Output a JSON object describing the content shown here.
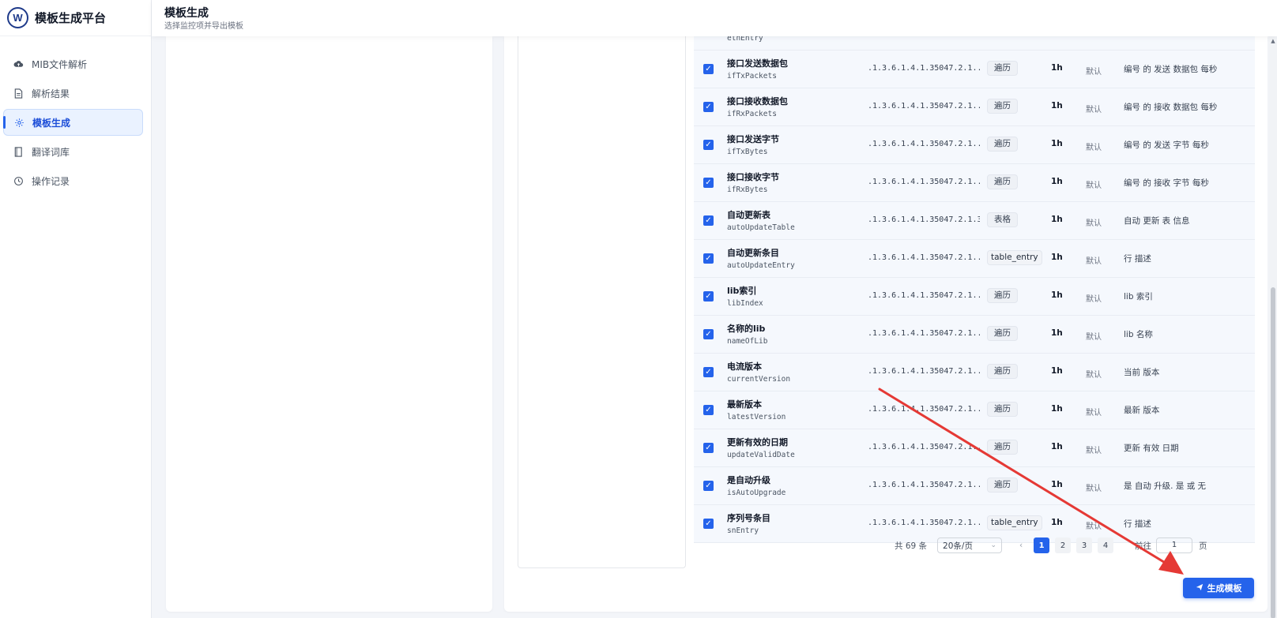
{
  "app": {
    "logo_text": "W",
    "title": "模板生成平台"
  },
  "sidebar": {
    "items": [
      {
        "label": "MIB文件解析",
        "icon": "cloud-upload-icon"
      },
      {
        "label": "解析结果",
        "icon": "document-icon"
      },
      {
        "label": "模板生成",
        "icon": "gear-icon",
        "active": true
      },
      {
        "label": "翻译词库",
        "icon": "book-icon"
      },
      {
        "label": "操作记录",
        "icon": "clock-icon"
      }
    ]
  },
  "header": {
    "title": "模板生成",
    "subtitle": "选择监控项并导出模板"
  },
  "table": {
    "partial_row": {
      "en": "ethEntry"
    },
    "rows": [
      {
        "cn": "接口发送数据包",
        "en": "ifTxPackets",
        "oid": ".1.3.6.1.4.1.35047.2.1...",
        "type": "遍历",
        "interval": "1h",
        "mode": "默认",
        "desc": "编号 的 发送 数据包 每秒"
      },
      {
        "cn": "接口接收数据包",
        "en": "ifRxPackets",
        "oid": ".1.3.6.1.4.1.35047.2.1...",
        "type": "遍历",
        "interval": "1h",
        "mode": "默认",
        "desc": "编号 的 接收 数据包 每秒"
      },
      {
        "cn": "接口发送字节",
        "en": "ifTxBytes",
        "oid": ".1.3.6.1.4.1.35047.2.1...",
        "type": "遍历",
        "interval": "1h",
        "mode": "默认",
        "desc": "编号 的 发送 字节 每秒"
      },
      {
        "cn": "接口接收字节",
        "en": "ifRxBytes",
        "oid": ".1.3.6.1.4.1.35047.2.1...",
        "type": "遍历",
        "interval": "1h",
        "mode": "默认",
        "desc": "编号 的 接收 字节 每秒"
      },
      {
        "cn": "自动更新表",
        "en": "autoUpdateTable",
        "oid": ".1.3.6.1.4.1.35047.2.1.3",
        "type": "表格",
        "interval": "1h",
        "mode": "默认",
        "desc": "自动 更新 表 信息"
      },
      {
        "cn": "自动更新条目",
        "en": "autoUpdateEntry",
        "oid": ".1.3.6.1.4.1.35047.2.1...",
        "type": "table_entry",
        "interval": "1h",
        "mode": "默认",
        "desc": "行 描述"
      },
      {
        "cn": "lib索引",
        "en": "libIndex",
        "oid": ".1.3.6.1.4.1.35047.2.1...",
        "type": "遍历",
        "interval": "1h",
        "mode": "默认",
        "desc": "lib 索引"
      },
      {
        "cn": "名称的lib",
        "en": "nameOfLib",
        "oid": ".1.3.6.1.4.1.35047.2.1...",
        "type": "遍历",
        "interval": "1h",
        "mode": "默认",
        "desc": "lib 名称"
      },
      {
        "cn": "电流版本",
        "en": "currentVersion",
        "oid": ".1.3.6.1.4.1.35047.2.1...",
        "type": "遍历",
        "interval": "1h",
        "mode": "默认",
        "desc": "当前 版本"
      },
      {
        "cn": "最新版本",
        "en": "latestVersion",
        "oid": ".1.3.6.1.4.1.35047.2.1...",
        "type": "遍历",
        "interval": "1h",
        "mode": "默认",
        "desc": "最新 版本"
      },
      {
        "cn": "更新有效的日期",
        "en": "updateValidDate",
        "oid": ".1.3.6.1.4.1.35047.2.1...",
        "type": "遍历",
        "interval": "1h",
        "mode": "默认",
        "desc": "更新 有效 日期"
      },
      {
        "cn": "是自动升级",
        "en": "isAutoUpgrade",
        "oid": ".1.3.6.1.4.1.35047.2.1...",
        "type": "遍历",
        "interval": "1h",
        "mode": "默认",
        "desc": "是 自动 升级. 是 或 无"
      },
      {
        "cn": "序列号条目",
        "en": "snEntry",
        "oid": ".1.3.6.1.4.1.35047.2.1...",
        "type": "table_entry",
        "interval": "1h",
        "mode": "默认",
        "desc": "行 描述"
      }
    ]
  },
  "pagination": {
    "total": "共 69 条",
    "page_size": "20条/页",
    "pages": [
      "1",
      "2",
      "3",
      "4"
    ],
    "current": "1",
    "goto_label": "前往",
    "goto_value": "1",
    "page_unit": "页"
  },
  "actions": {
    "generate_label": "生成模板"
  },
  "colors": {
    "accent": "#2563eb",
    "annotation_arrow": "#e53935"
  }
}
